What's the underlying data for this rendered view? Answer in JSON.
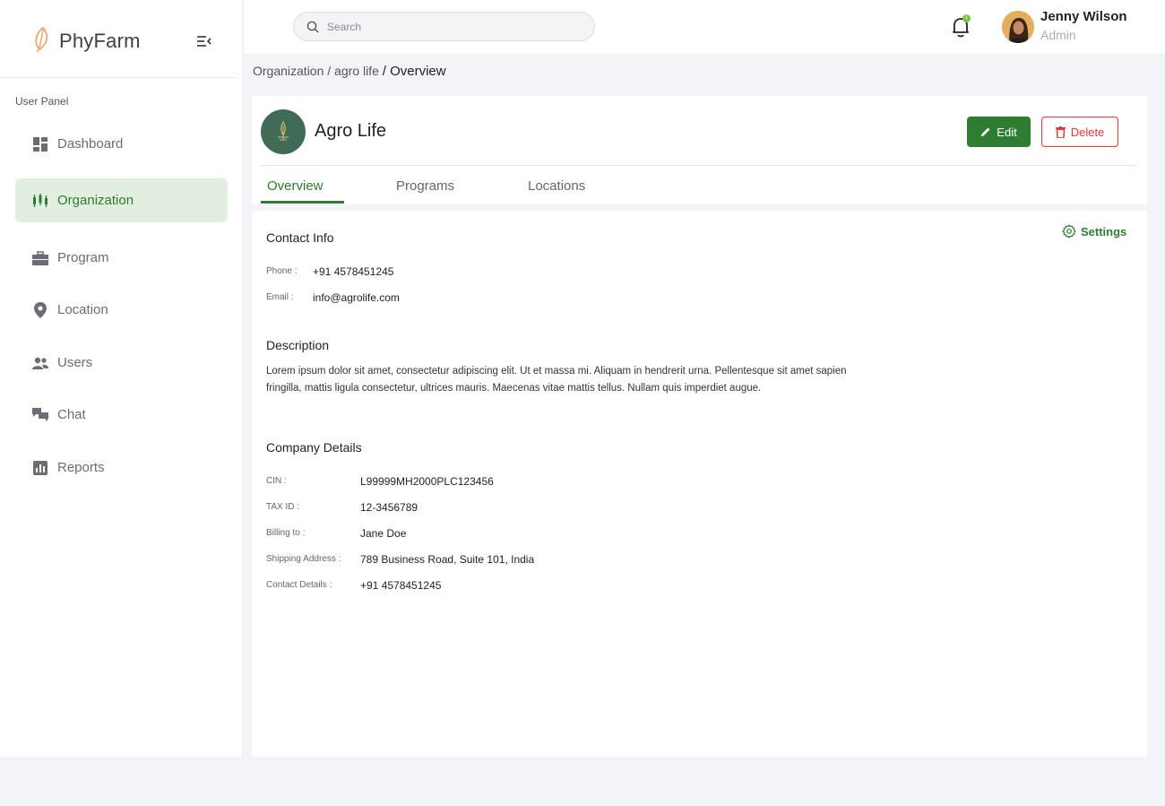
{
  "brand": {
    "name": "PhyFarm"
  },
  "sidebar": {
    "panel_label": "User Panel",
    "items": [
      {
        "label": "Dashboard",
        "icon": "dashboard-icon"
      },
      {
        "label": "Organization",
        "icon": "organization-icon",
        "active": true
      },
      {
        "label": "Program",
        "icon": "briefcase-icon"
      },
      {
        "label": "Location",
        "icon": "location-pin-icon"
      },
      {
        "label": "Users",
        "icon": "users-icon"
      },
      {
        "label": "Chat",
        "icon": "chat-icon"
      },
      {
        "label": "Reports",
        "icon": "reports-icon"
      }
    ]
  },
  "header": {
    "search_placeholder": "Search",
    "notification_count": "1",
    "user": {
      "name": "Jenny Wilson",
      "role": "Admin"
    }
  },
  "breadcrumb": {
    "path": "Organization / agro life",
    "current": "/ Overview"
  },
  "org": {
    "name": "Agro Life",
    "edit_label": "Edit",
    "delete_label": "Delete",
    "tabs": [
      "Overview",
      "Programs",
      "Locations"
    ],
    "active_tab": "Overview"
  },
  "overview": {
    "settings_label": "Settings",
    "contact": {
      "title": "Contact Info",
      "phone_label": "Phone :",
      "phone": "+91 4578451245",
      "email_label": "Email :",
      "email": "info@agrolife.com"
    },
    "description": {
      "title": "Description",
      "text": "Lorem ipsum dolor sit amet, consectetur adipiscing elit. Ut et massa mi. Aliquam in hendrerit urna. Pellentesque sit amet sapien fringilla, mattis ligula consectetur, ultrices mauris. Maecenas vitae mattis tellus. Nullam quis imperdiet augue."
    },
    "company": {
      "title": "Company Details",
      "fields": [
        {
          "label": "CIN :",
          "value": "L99999MH2000PLC123456"
        },
        {
          "label": "TAX ID :",
          "value": "12-3456789"
        },
        {
          "label": "Billing to :",
          "value": "Jane Doe"
        },
        {
          "label": "Shipping Address :",
          "value": "789 Business Road, Suite 101, India"
        },
        {
          "label": "Contact Details :",
          "value": "+91 4578451245"
        }
      ]
    }
  },
  "colors": {
    "accent": "#2e7d32",
    "danger": "#e53935",
    "active_nav_bg": "#e2eee0"
  }
}
